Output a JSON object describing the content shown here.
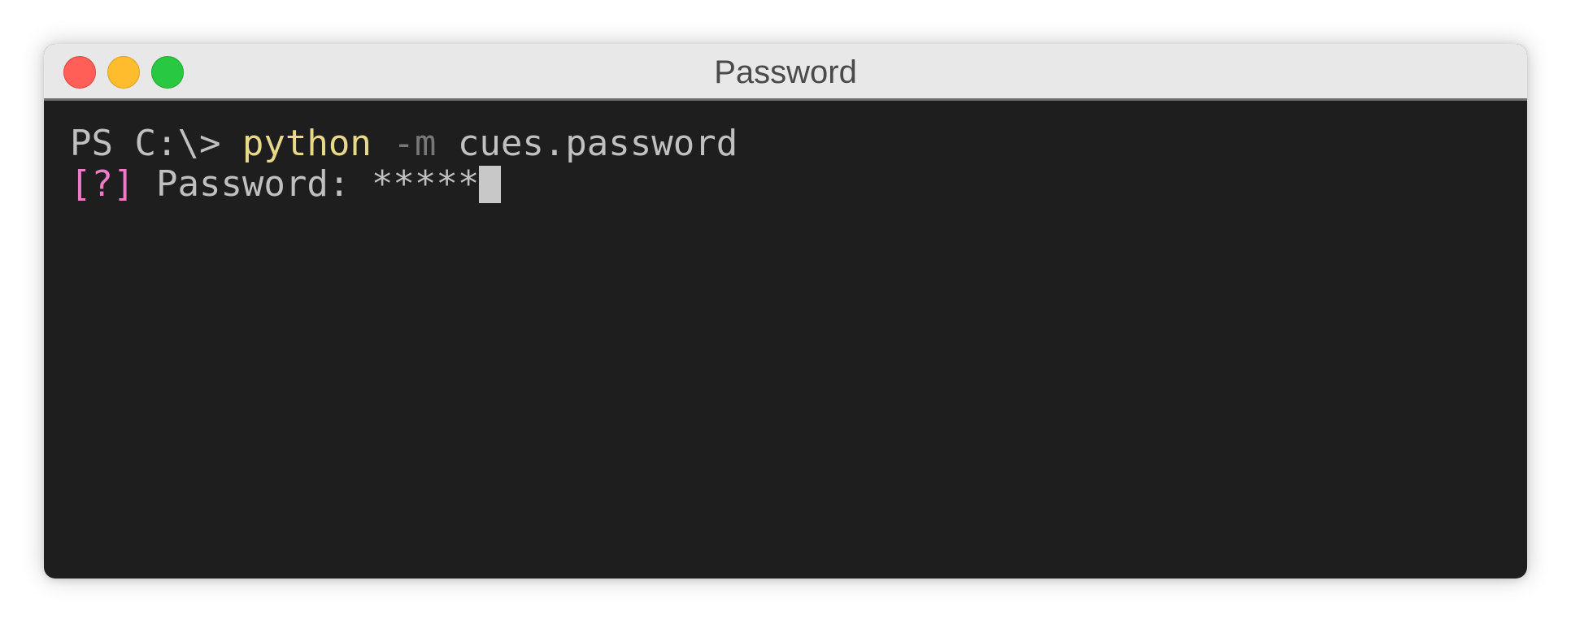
{
  "window": {
    "title": "Password",
    "buttons": {
      "close": "close",
      "minimize": "minimize",
      "maximize": "maximize"
    }
  },
  "terminal": {
    "line1": {
      "prompt": "PS C:\\> ",
      "command": "python",
      "flag": " -m",
      "argument": " cues.password"
    },
    "line2": {
      "marker": "[?]",
      "label": " Password: ",
      "value": "*****"
    }
  },
  "colors": {
    "background": "#1e1e1e",
    "text": "#c0c0c0",
    "command": "#e8d98a",
    "flag": "#777777",
    "marker": "#ee7bc6",
    "cursor": "#c8c8c8"
  }
}
